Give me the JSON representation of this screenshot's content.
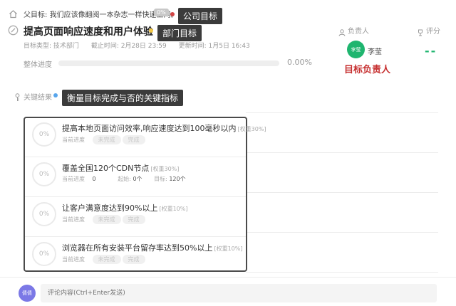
{
  "parent": {
    "label": "父目标:",
    "text": "我们应该像翻阅一本杂志一样快速上网。",
    "badge": "0%"
  },
  "callouts": {
    "company": "公司目标",
    "department": "部门目标",
    "owner": "目标负责人",
    "kr": "衡量目标完成与否的关键指标"
  },
  "objective": {
    "title": "提高页面响应速度和用户体验",
    "type_label": "目标类型:",
    "type_value": "技术部门",
    "deadline_label": "截止时间:",
    "deadline_value": "2月28日 23:59",
    "updated_label": "更新时间:",
    "updated_value": "1月5日 16:43",
    "progress_label": "整体进度",
    "progress_value": "0.00%",
    "progress": 0
  },
  "owner": {
    "header": "负责人",
    "avatar_text": "李莹",
    "name": "李莹"
  },
  "score": {
    "header": "评分",
    "value": "--"
  },
  "kr_section": {
    "label": "关键结果"
  },
  "key_results": [
    {
      "pct": "0%",
      "title": "提高本地页面访问效率,响应速度达到100毫秒以内",
      "weight": "[权重30%]",
      "sub_label": "当前进度",
      "states": [
        "未完成",
        "完成"
      ]
    },
    {
      "pct": "0%",
      "title": "覆盖全国120个CDN节点",
      "weight": "[权重30%]",
      "sub_label": "当前进度",
      "current": "0",
      "start_label": "起始:",
      "start_value": "0个",
      "target_label": "目标:",
      "target_value": "120个"
    },
    {
      "pct": "0%",
      "title": "让客户满意度达到90%以上",
      "weight": "[权重10%]",
      "sub_label": "当前进度",
      "states": [
        "未完成",
        "完成"
      ]
    },
    {
      "pct": "0%",
      "title": "浏览器在所有安装平台留存率达到50%以上",
      "weight": "[权重10%]",
      "sub_label": "当前进度",
      "states": [
        "未完成",
        "完成"
      ]
    }
  ],
  "comment": {
    "avatar_text": "倩倩",
    "placeholder": "评论内容(Ctrl+Enter发送)"
  },
  "colors": {
    "accent_green": "#1fb56f",
    "red": "#c62f2f",
    "purple": "#7b78e6",
    "dot_blue": "#58a6ec",
    "dot_red": "#d24545",
    "dot_yellow": "#f2c744"
  }
}
